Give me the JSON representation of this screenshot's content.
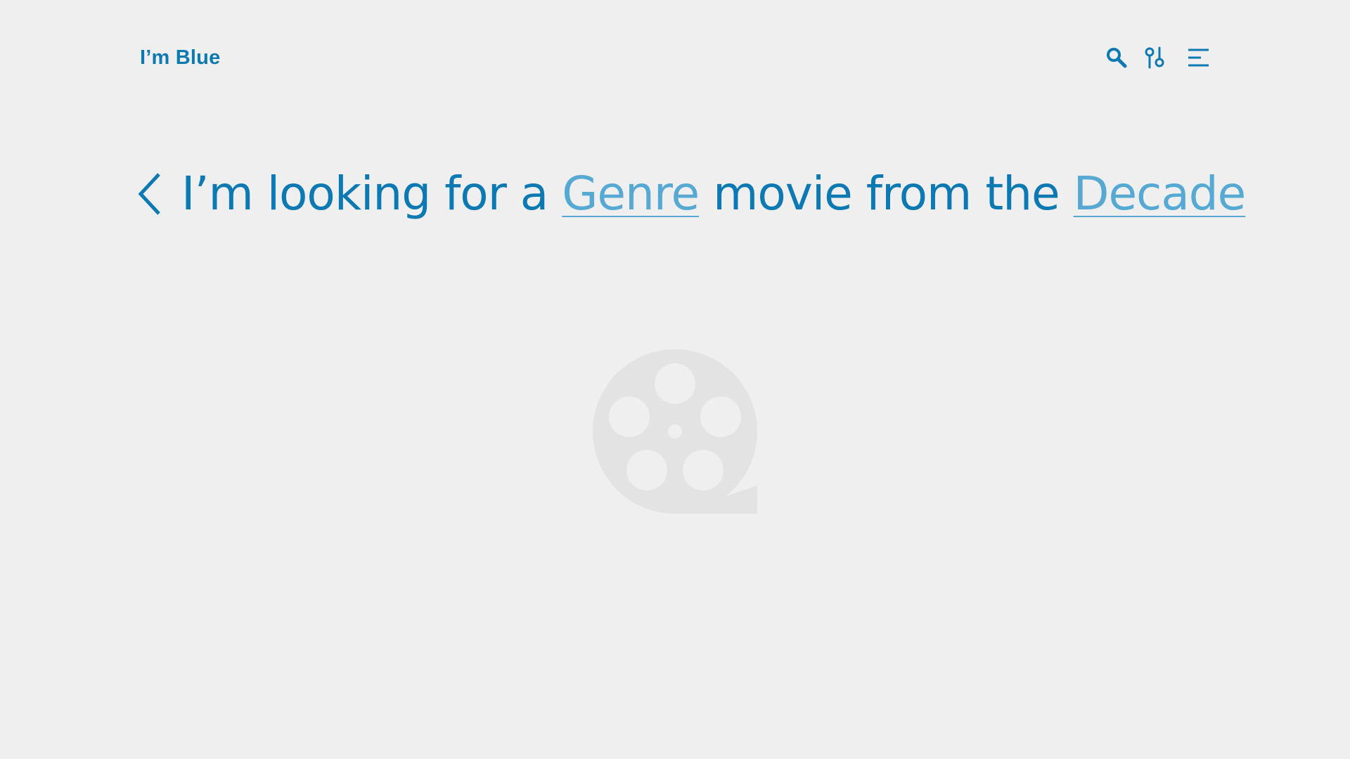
{
  "header": {
    "brand": "I’m Blue",
    "icons": [
      "search-icon",
      "filter-sliders-icon",
      "menu-icon"
    ]
  },
  "query": {
    "prefix": "I’m looking for a",
    "genre": "Genre",
    "middle": "movie from the",
    "decade": "Decade"
  },
  "colors": {
    "background": "#efefef",
    "primary": "#0c79b3",
    "link": "#55a9d2",
    "placeholder": "#e3e3e3"
  },
  "placeholder_icon": "film-reel-icon"
}
